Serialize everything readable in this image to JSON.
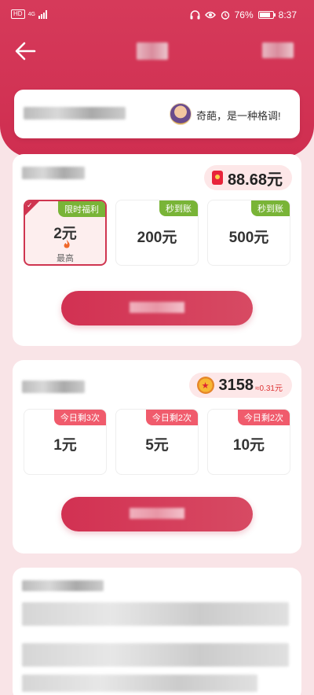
{
  "status_bar": {
    "hd": "HD",
    "network": "4G",
    "battery_percent": "76%",
    "time": "8:37"
  },
  "notice": {
    "message": "奇葩，是一种格调!"
  },
  "cash_section": {
    "balance": "88.68元",
    "options": [
      {
        "tag": "限时福利",
        "value": "2元",
        "note": "最高",
        "selected": true
      },
      {
        "tag": "秒到账",
        "value": "200元",
        "selected": false
      },
      {
        "tag": "秒到账",
        "value": "500元",
        "selected": false
      }
    ]
  },
  "coin_section": {
    "coins": "3158",
    "coins_equiv": "≈0.31元",
    "options": [
      {
        "tag": "今日剩3次",
        "value": "1元"
      },
      {
        "tag": "今日剩2次",
        "value": "5元"
      },
      {
        "tag": "今日剩2次",
        "value": "10元"
      }
    ]
  },
  "colors": {
    "brand": "#cf2e50",
    "accent_green": "#79b437",
    "tag_red": "#f05b6c"
  }
}
